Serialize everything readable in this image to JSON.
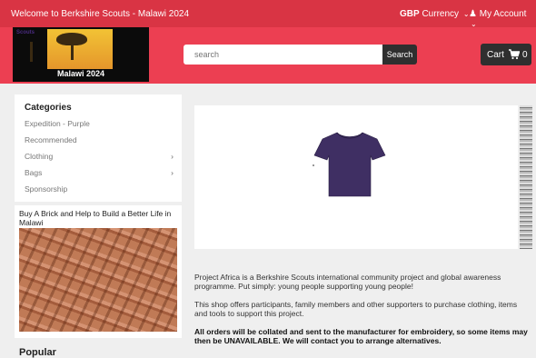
{
  "topbar": {
    "welcome": "Welcome to Berkshire Scouts - Malawi 2024",
    "currency_code": "GBP",
    "currency_label": "Currency",
    "account": "My Account"
  },
  "logo": {
    "brand": "Scouts",
    "caption": "Malawi 2024"
  },
  "search": {
    "placeholder": "search",
    "button": "Search"
  },
  "cart": {
    "label": "Cart",
    "count": "0"
  },
  "categories": {
    "title": "Categories",
    "items": [
      {
        "label": "Expedition - Purple"
      },
      {
        "label": "Recommended"
      },
      {
        "label": "Clothing"
      },
      {
        "label": "Bags"
      },
      {
        "label": "Sponsorship"
      }
    ]
  },
  "promo": {
    "title": "Buy A Brick and Help to Build a Better Life in Malawi"
  },
  "popular": {
    "title": "Popular"
  },
  "product": {
    "shirt_color": "#3f2f63"
  },
  "description": {
    "p1": "Project Africa is a Berkshire Scouts international community project and global awareness programme. Put simply: young people supporting young people!",
    "p2": "This shop offers participants, family members and other supporters to purchase clothing, items and tools to support this project.",
    "p3": "All orders will be collated and sent to the manufacturer for embroidery, so some items may then be UNAVAILABLE. We will contact you to arrange alternatives."
  }
}
